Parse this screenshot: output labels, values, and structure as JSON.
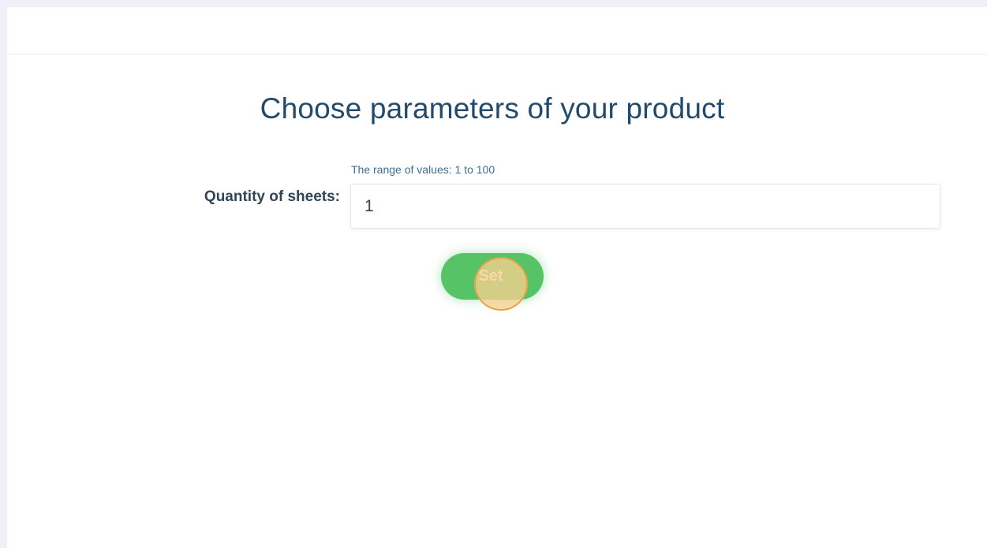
{
  "header": {},
  "main": {
    "title": "Choose parameters of your product",
    "quantity": {
      "label": "Quantity of sheets:",
      "range_hint": "The range of values: 1 to 100",
      "value": "1"
    },
    "set_button_label": "Set"
  },
  "colors": {
    "page_background": "#eff0f8",
    "title": "#234a6b",
    "hint": "#3d6f95",
    "button": "#55c366",
    "click_marker": "#f7d08e"
  }
}
